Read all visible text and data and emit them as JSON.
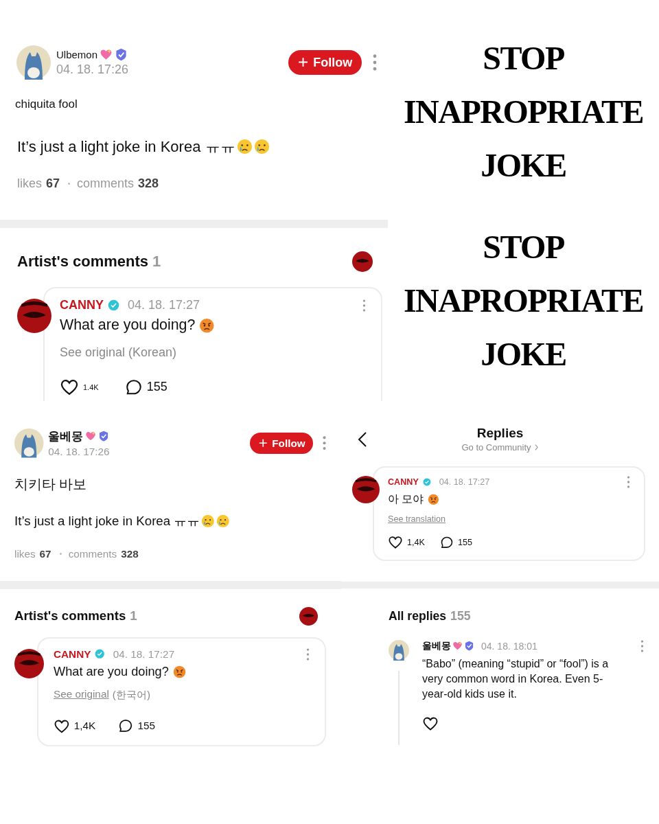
{
  "captions": [
    {
      "lines": [
        "STOP",
        "INAPROPRIATE",
        "JOKE"
      ]
    },
    {
      "lines": [
        "STOP",
        "INAPROPRIATE",
        "JOKE"
      ]
    }
  ],
  "posts": [
    {
      "author": "Ulbemon",
      "time": "04. 18. 17:26",
      "follow_label": "Follow",
      "body": [
        {
          "text": "chiquita fool"
        },
        {
          "text": "It’s just a light joke in Korea ㅠㅠ"
        }
      ],
      "likes_label": "likes",
      "likes": "67",
      "comments_label": "comments",
      "comments": "328",
      "artist_comments": {
        "title": "Artist's comments",
        "count": "1",
        "comment": {
          "author": "CANNY",
          "time": "04. 18. 17:27",
          "text": "What are you doing?",
          "translate": {
            "link": "See original (Korean)",
            "underlined": false
          },
          "likes": "1.4K",
          "replies": "155"
        }
      }
    },
    {
      "author": "울베몽",
      "time": "04. 18. 17:26",
      "follow_label": "Follow",
      "body": [
        {
          "text": "치키타 바보"
        },
        {
          "text": "It’s just a light joke in Korea ㅠㅠ"
        }
      ],
      "likes_label": "likes",
      "likes": "67",
      "comments_label": "comments",
      "comments": "328",
      "artist_comments": {
        "title": "Artist's comments",
        "count": "1",
        "comment": {
          "author": "CANNY",
          "time": "04. 18. 17:27",
          "text": "What are you doing?",
          "translate": {
            "link": "See original",
            "underlined": true,
            "suffix": "(한국어)"
          },
          "likes": "1,4K",
          "replies": "155"
        }
      }
    }
  ],
  "replies_screen": {
    "title": "Replies",
    "subtitle": "Go to Community",
    "comment": {
      "author": "CANNY",
      "time": "04. 18. 17:27",
      "text": "아 모야",
      "translate": {
        "link": "See translation",
        "underlined": true
      },
      "likes": "1,4K",
      "replies": "155"
    },
    "all_replies_label": "All replies",
    "all_replies_count": "155",
    "replies": [
      {
        "author": "울베몽",
        "time": "04. 18. 18:01",
        "text": "“Babo” (meaning “stupid” or “fool”) is a very common word in Korea. Even 5-year-old kids use it."
      }
    ]
  }
}
